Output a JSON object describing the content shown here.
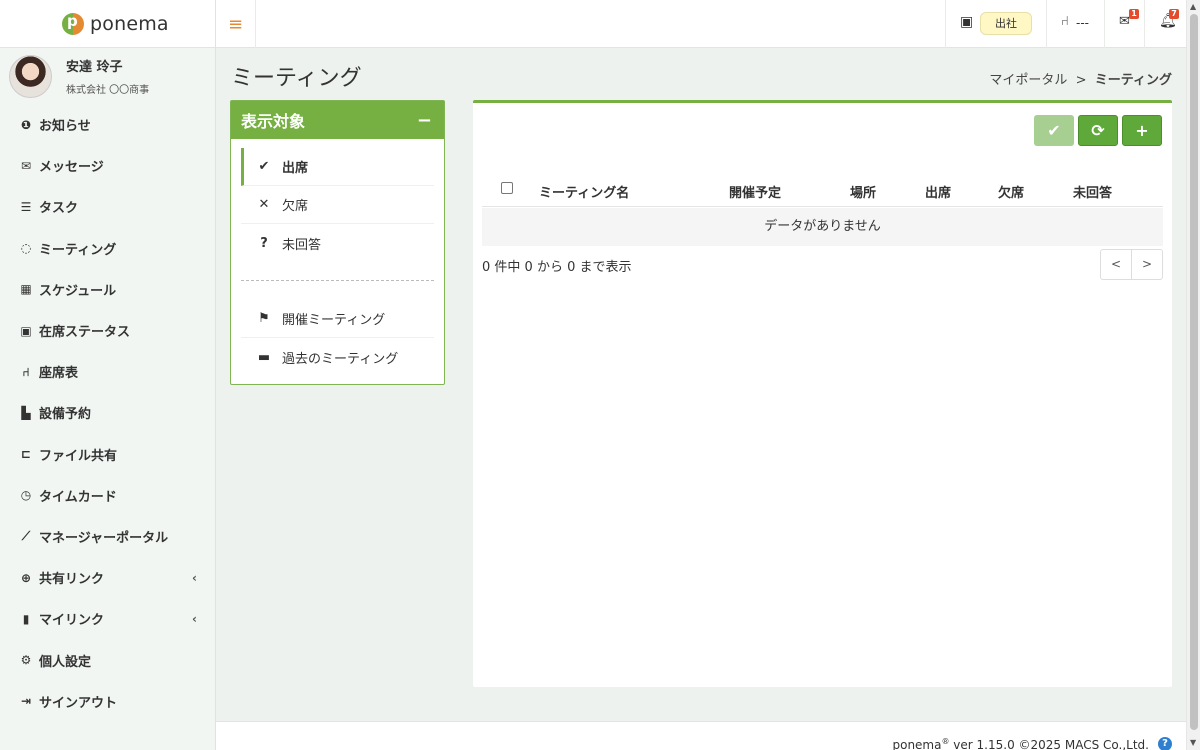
{
  "app": {
    "logo_text": "ponema"
  },
  "user": {
    "name": "安達 玲子",
    "company": "株式会社 〇〇商事"
  },
  "sidebar": {
    "items": [
      {
        "label": "お知らせ",
        "icon": "info-circle-icon"
      },
      {
        "label": "メッセージ",
        "icon": "envelope-icon"
      },
      {
        "label": "タスク",
        "icon": "tasks-icon"
      },
      {
        "label": "ミーティング",
        "icon": "comments-icon"
      },
      {
        "label": "スケジュール",
        "icon": "calendar-icon"
      },
      {
        "label": "在席ステータス",
        "icon": "presence-board-icon"
      },
      {
        "label": "座席表",
        "icon": "chair-icon"
      },
      {
        "label": "設備予約",
        "icon": "door-icon"
      },
      {
        "label": "ファイル共有",
        "icon": "folder-open-icon"
      },
      {
        "label": "タイムカード",
        "icon": "clock-icon"
      },
      {
        "label": "マネージャーポータル",
        "icon": "line-chart-icon"
      },
      {
        "label": "共有リンク",
        "icon": "globe-icon"
      },
      {
        "label": "マイリンク",
        "icon": "bookmark-icon"
      },
      {
        "label": "個人設定",
        "icon": "gear-icon"
      },
      {
        "label": "サインアウト",
        "icon": "sign-out-icon"
      }
    ]
  },
  "header": {
    "status_label": "出社",
    "seat_value": "---",
    "mail_count": "1",
    "notification_count": "7"
  },
  "page": {
    "title": "ミーティング"
  },
  "breadcrumb": {
    "parent": "マイポータル",
    "separator": ">",
    "current": "ミーティング"
  },
  "filter": {
    "title": "表示対象",
    "collapse_label": "−",
    "items": [
      {
        "label": "出席",
        "glyph": "✔"
      },
      {
        "label": "欠席",
        "glyph": "✕"
      },
      {
        "label": "未回答",
        "glyph": "?"
      },
      {
        "label": "開催ミーティング",
        "glyph": "⚑"
      },
      {
        "label": "過去のミーティング",
        "glyph": "▬"
      }
    ]
  },
  "toolbar": {
    "check_glyph": "✔",
    "refresh_glyph": "⟳",
    "add_glyph": "+"
  },
  "table": {
    "columns": [
      "ミーティング名",
      "開催予定",
      "場所",
      "出席",
      "欠席",
      "未回答"
    ],
    "empty_message": "データがありません",
    "info": "0 件中 0 から 0 まで表示",
    "prev": "<",
    "next": ">"
  },
  "footer": {
    "product": "ponema",
    "trademark": "®",
    "version_text": " ver 1.15.0 ©2025 MACS Co.,Ltd.",
    "help_glyph": "?"
  },
  "colors": {
    "brand_green": "#76b043",
    "accent_orange": "#e58a33",
    "badge_red": "#e24b2e"
  }
}
